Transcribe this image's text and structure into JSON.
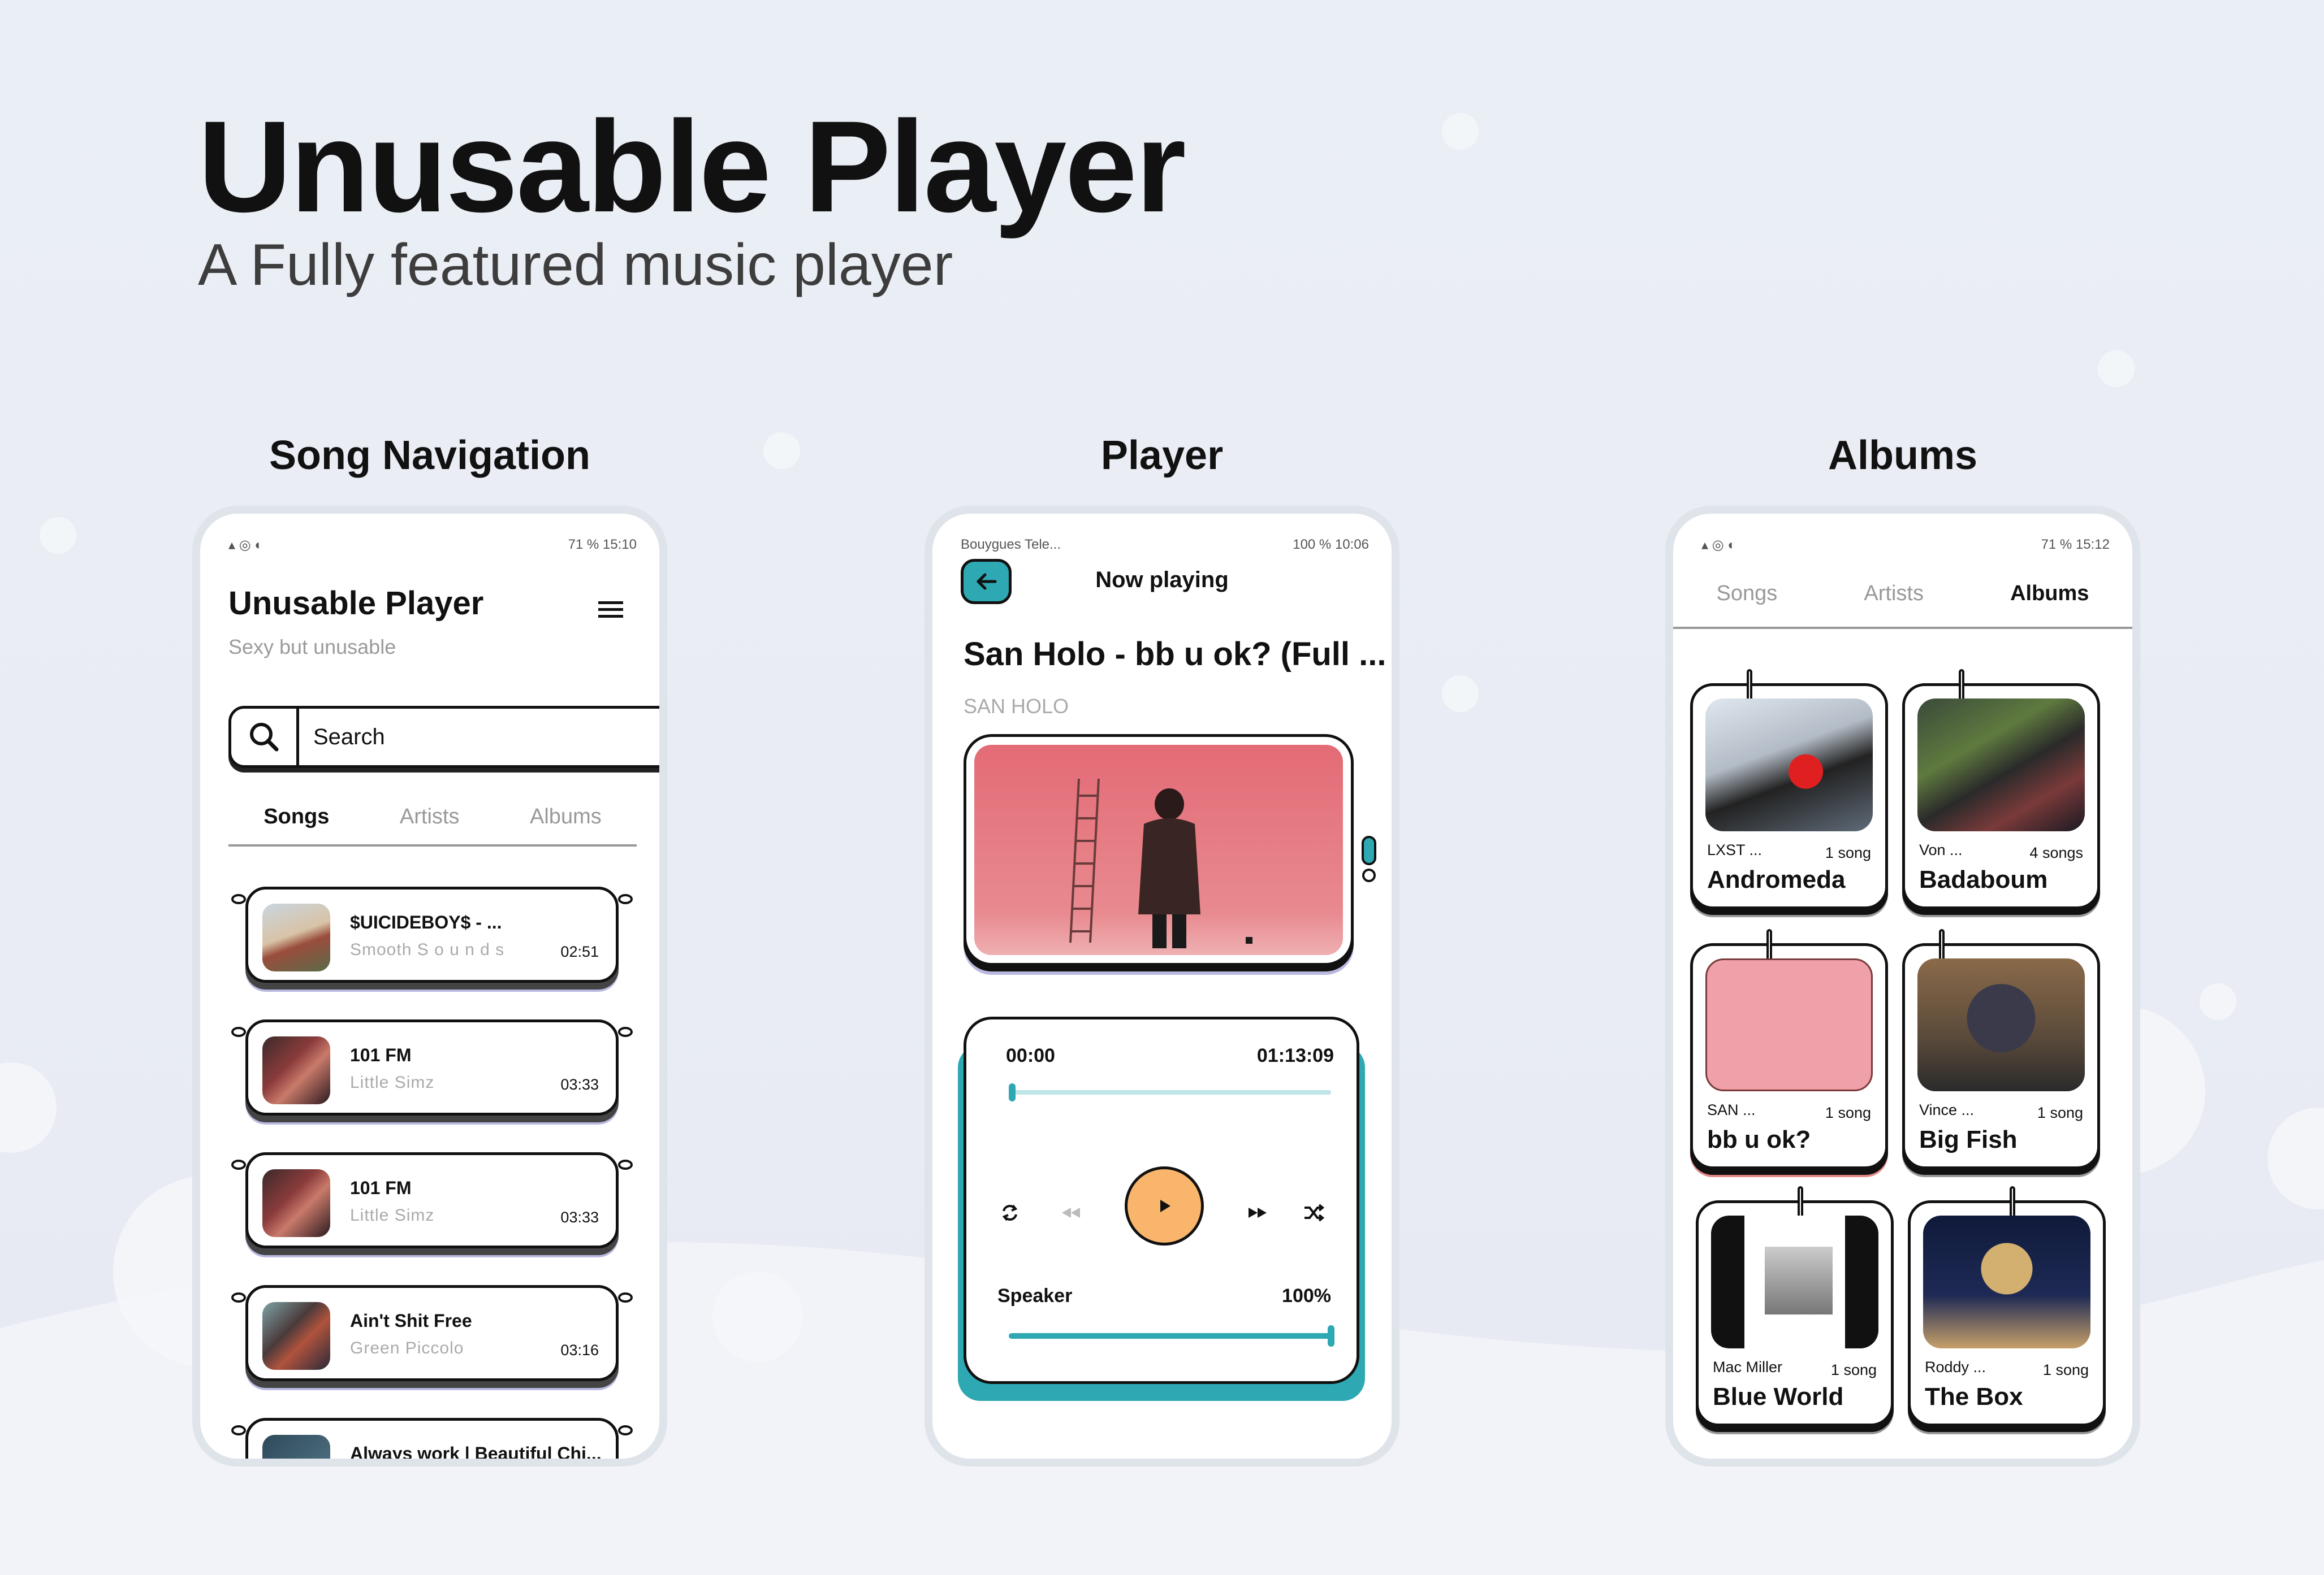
{
  "hero": {
    "title": "Unusable Player",
    "subtitle": "A Fully featured music player"
  },
  "sections": {
    "nav": "Song Navigation",
    "player": "Player",
    "albums": "Albums"
  },
  "colors": {
    "accent_orange": "#f8b56b",
    "accent_teal": "#2ea8b2",
    "shadow_lavender": "#b9b9e0"
  },
  "phone1": {
    "status_left": "▴ ◎ ◐",
    "status_right": "71 %  15:10",
    "app_title": "Unusable Player",
    "app_subtitle": "Sexy but unusable",
    "menu_icon": "hamburger-icon",
    "search_placeholder": "Search",
    "tabs": [
      "Songs",
      "Artists",
      "Albums"
    ],
    "songs": [
      {
        "title": "$UICIDEBOY$ - ...",
        "artist": "Smooth S o u n d s",
        "duration": "02:51"
      },
      {
        "title": "101 FM",
        "artist": "Little Simz",
        "duration": "03:33"
      },
      {
        "title": "101 FM",
        "artist": "Little Simz",
        "duration": "03:33"
      },
      {
        "title": "Ain't Shit Free",
        "artist": "Green Piccolo",
        "duration": "03:16"
      },
      {
        "title": "Always work | Beautiful Chi...",
        "artist": "",
        "duration": ""
      }
    ]
  },
  "phone2": {
    "status_left": "Bouygues Tele...",
    "status_right": "100 %  10:06",
    "header": "Now playing",
    "song_title": "San Holo - bb u ok? (Full ...",
    "song_artist": "SAN HOLO",
    "time_current": "00:00",
    "time_total": "01:13:09",
    "progress": 0.0,
    "output_label": "Speaker",
    "volume_label": "100%",
    "volume": 1.0
  },
  "phone3": {
    "status_right": "71 %  15:12",
    "tabs": [
      "Songs",
      "Artists",
      "Albums"
    ],
    "albums": [
      {
        "artist": "LXST ...",
        "count": "1 song",
        "title": "Andromeda"
      },
      {
        "artist": "Von ...",
        "count": "4 songs",
        "title": "Badaboum"
      },
      {
        "artist": "SAN ...",
        "count": "1 song",
        "title": "bb u ok?"
      },
      {
        "artist": "Vince ...",
        "count": "1 song",
        "title": "Big Fish"
      },
      {
        "artist": "Mac Miller",
        "count": "1 song",
        "title": "Blue World"
      },
      {
        "artist": "Roddy ...",
        "count": "1 song",
        "title": "The Box"
      }
    ]
  }
}
